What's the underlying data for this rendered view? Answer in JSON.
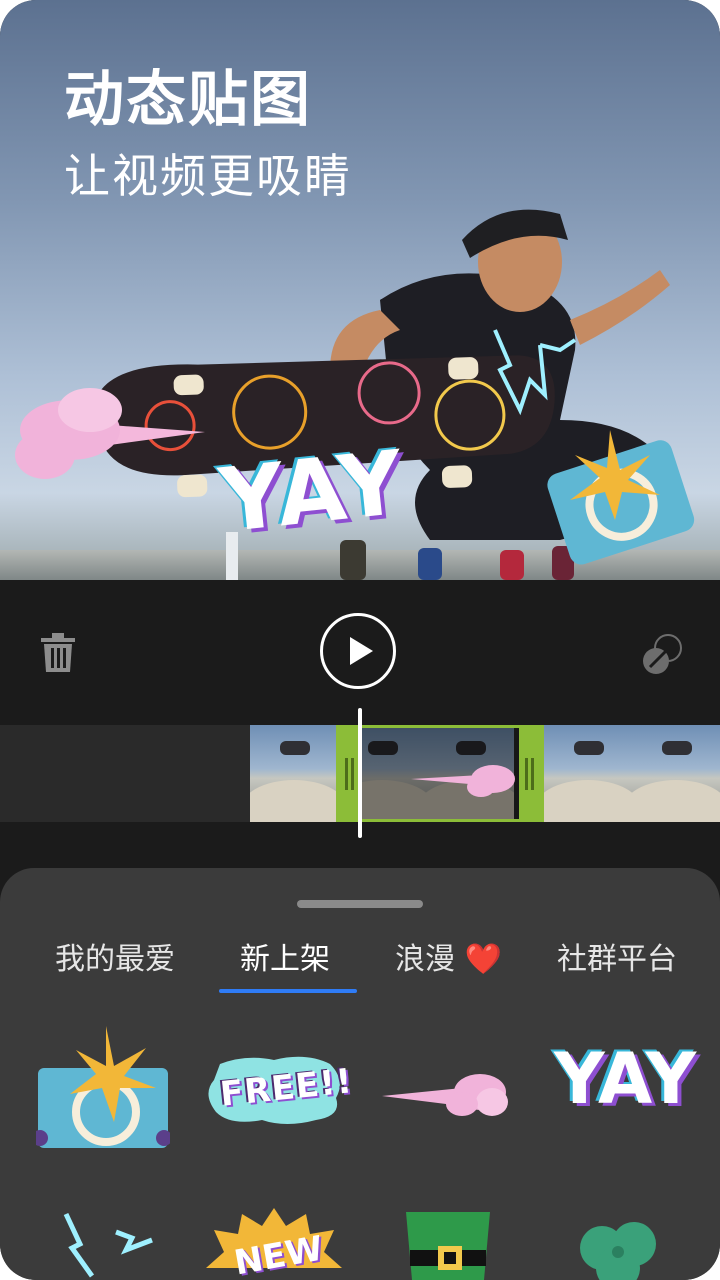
{
  "hero": {
    "title": "动态贴图",
    "subtitle": "让视频更吸睛",
    "overlay_sticker_text": "YAY"
  },
  "controls": {
    "delete_icon": "trash-icon",
    "play_icon": "play-icon",
    "expand_icon": "expand-icon"
  },
  "sheet": {
    "tabs": [
      {
        "label": "我的最爱"
      },
      {
        "label": "新上架"
      },
      {
        "label": "浪漫 ❤️"
      },
      {
        "label": "社群平台"
      }
    ],
    "active_tab": "新上架",
    "stickers_row1": [
      {
        "name": "sunburst-card-sticker"
      },
      {
        "name": "free-sticker",
        "text": "FREE!!"
      },
      {
        "name": "pink-cloud-trail-sticker"
      },
      {
        "name": "yay-sticker",
        "text": "YAY"
      }
    ],
    "stickers_row2": [
      {
        "name": "lightning-sticker"
      },
      {
        "name": "new-sticker",
        "text": "NEW"
      },
      {
        "name": "green-hat-sticker"
      },
      {
        "name": "shamrock-sticker"
      }
    ]
  },
  "colors": {
    "accent": "#2f7cf6",
    "trim_handle": "#8cbd38",
    "sheet_bg": "#3b3b3b",
    "app_bg": "#1b1b1b"
  }
}
